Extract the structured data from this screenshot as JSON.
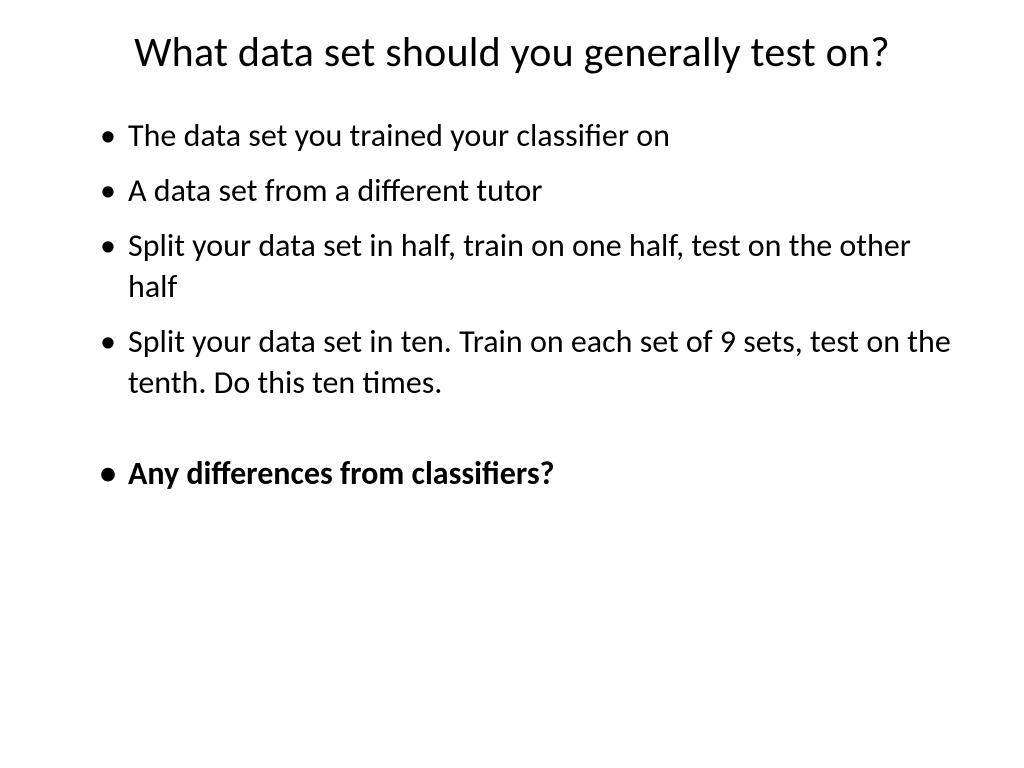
{
  "slide": {
    "title": "What data set should you generally test on?",
    "bullets": [
      {
        "text": "The data set you trained your classifier on",
        "bold": false
      },
      {
        "text": "A data set from a different tutor",
        "bold": false
      },
      {
        "text": "Split your data set in half, train on one half, test on the other half",
        "bold": false
      },
      {
        "text": "Split your data set in ten. Train on each set of 9 sets, test on the tenth. Do this ten times.",
        "bold": false
      },
      {
        "text": "",
        "spacer": true
      },
      {
        "text": "Any differences from classifiers?",
        "bold": true
      }
    ]
  }
}
